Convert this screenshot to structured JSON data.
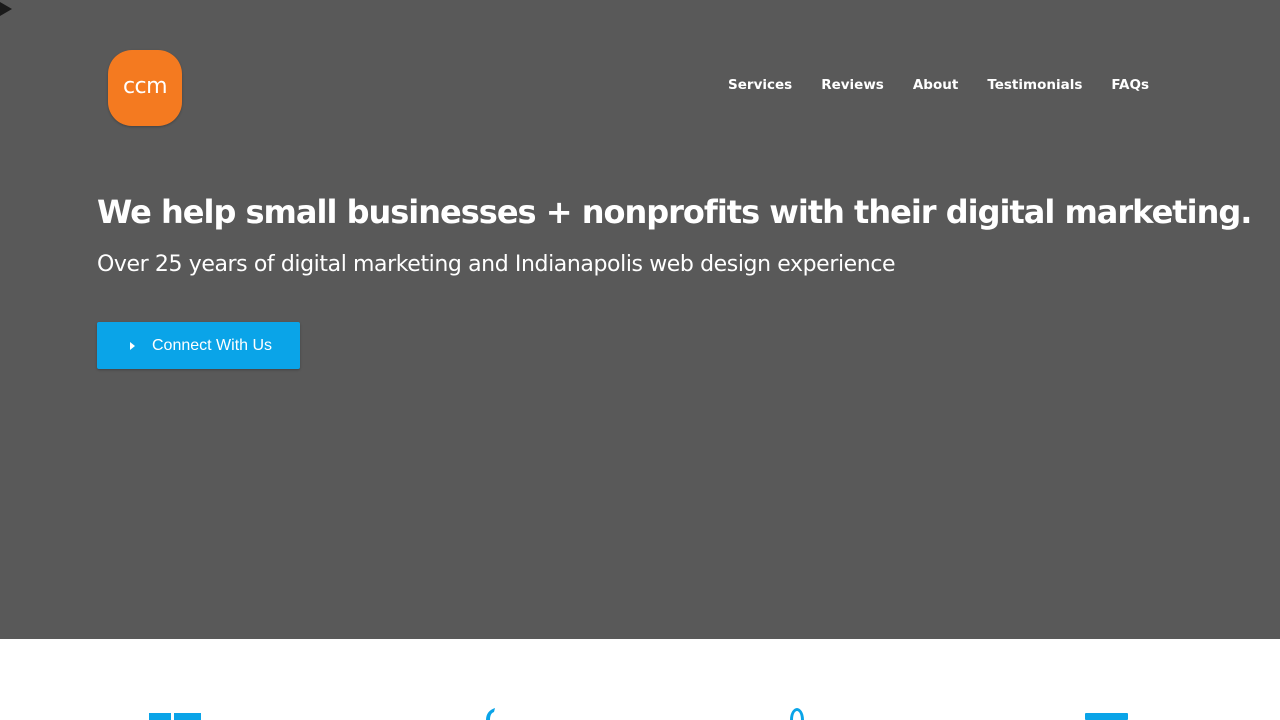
{
  "brand": {
    "logo_text": "ccm",
    "logo_color": "#f47a20"
  },
  "nav": {
    "items": [
      {
        "label": "Services"
      },
      {
        "label": "Reviews"
      },
      {
        "label": "About"
      },
      {
        "label": "Testimonials"
      },
      {
        "label": "FAQs"
      }
    ]
  },
  "hero": {
    "background_color": "#595959",
    "headline": "We help small businesses + nonprofits with their digital marketing.",
    "subheadline": "Over 25 years of digital marketing and Indianapolis web design experience",
    "cta": {
      "label": "Connect With Us",
      "icon": "play-icon",
      "color": "#0aa4e8"
    }
  },
  "services_icons": {
    "accent_color": "#0aa4e8",
    "icons": [
      "layout-icon",
      "leaf-icon",
      "pin-icon",
      "monitor-icon"
    ]
  }
}
